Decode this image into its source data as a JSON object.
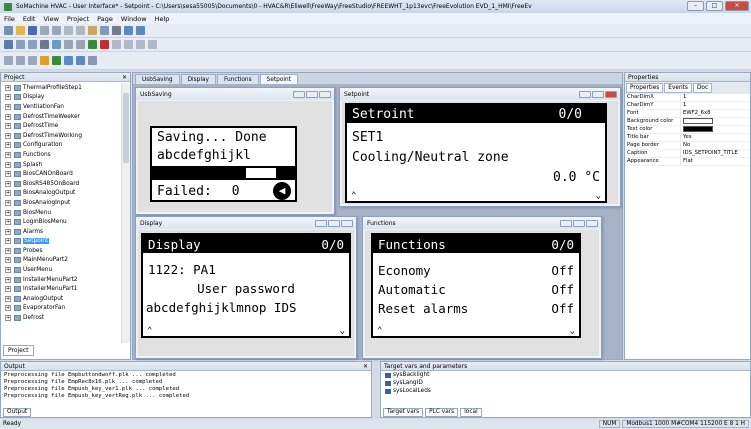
{
  "window": {
    "title": "SoMachine HVAC - User Interface* - Setpoint - C:\\Users\\sesa55005\\Documents\\0 - HVAC&R\\Eliwell\\FreeWay\\FreeStudio\\FREEWHT_1p13evc\\FreeEvolution EVD_1_HMI\\FreeEv"
  },
  "menu": [
    "File",
    "Edit",
    "View",
    "Project",
    "Page",
    "Window",
    "Help"
  ],
  "project": {
    "title": "Project",
    "items": [
      "ThermalProfileStep1",
      "Display",
      "VentilationFan",
      "DefrostTimeWeeker",
      "DefrostTime",
      "DefrostTimeWorking",
      "Configuration",
      "Functions",
      "Splash",
      "BiosCANOnBoard",
      "BiosRS485OnBoard",
      "BiosAnalogOutput",
      "BiosAnalogInput",
      "BiosMenu",
      "LoginBiosMenu",
      "Alarms",
      "Setpoint",
      "Probes",
      "MainMenuPart2",
      "UserMenu",
      "InstallerMenuPart2",
      "InstallerMenuPart1",
      "AnalogOutput",
      "EvaporatorFan",
      "Defrost"
    ],
    "selected_index": 16,
    "tab_label": "Project"
  },
  "doc_tabs": [
    "UsbSaving",
    "Display",
    "Functions",
    "Setpoint"
  ],
  "screens": {
    "usb": {
      "title": "UsbSaving",
      "line1": "Saving... Done",
      "line2": "abcdefghijkl",
      "line4_label": "Failed:",
      "line4_value": "0"
    },
    "setpoint": {
      "title": "Setpoint",
      "header": "Setroint",
      "page": "0/0",
      "line2": "SET1",
      "line3": "Cooling/Neutral zone",
      "value": "0.0 °C"
    },
    "display": {
      "title": "Display",
      "header": "Display",
      "page": "0/0",
      "line2": "1122: PA1",
      "line3": "User password",
      "line4": "abcdefghijklmnop IDS"
    },
    "functions": {
      "title": "Functions",
      "header": "Functions",
      "page": "0/0",
      "rows": [
        {
          "label": "Economy",
          "value": "Off"
        },
        {
          "label": "Automatic",
          "value": "Off"
        },
        {
          "label": "Reset alarms",
          "value": "Off"
        }
      ]
    }
  },
  "properties": {
    "title": "Properties",
    "tabs": [
      "Properties",
      "Events",
      "Doc"
    ],
    "rows": [
      {
        "name": "CharDimX",
        "value": "1"
      },
      {
        "name": "CharDimY",
        "value": "1"
      },
      {
        "name": "Font",
        "value": "EWF2_6x8"
      },
      {
        "name": "Background color",
        "value": ""
      },
      {
        "name": "Text color",
        "value": ""
      },
      {
        "name": "Title bar",
        "value": "Yes"
      },
      {
        "name": "Page border",
        "value": "No"
      },
      {
        "name": "Caption",
        "value": "IDS_SETPOINT_TITLE"
      },
      {
        "name": "Appearance",
        "value": "Flat"
      }
    ]
  },
  "output": {
    "title": "Output",
    "lines": [
      "Preprocessing file Empbuttondwoff.plk ... completed",
      "Preprocessing file EmpRec8x16.plk ... completed",
      "Preprocessing file Empusb_key_ver1.plk ... completed",
      "Preprocessing file Empusb_key_vertReg.plk ... completed"
    ],
    "tab_label": "Output"
  },
  "targets": {
    "title": "Target vars and parameters",
    "vars": [
      "sysBacklight",
      "sysLangID",
      "sysLocalLeds"
    ],
    "tabs": [
      "Target vars",
      "PLC vars",
      "local"
    ]
  },
  "status": {
    "left": "Ready",
    "num": "NUM",
    "conn": "Modbus1 1000 M#COM4 115200 E 8 1 H"
  },
  "colors": {
    "accent_selection": "#3399ff",
    "close_button": "#c94c3c"
  }
}
